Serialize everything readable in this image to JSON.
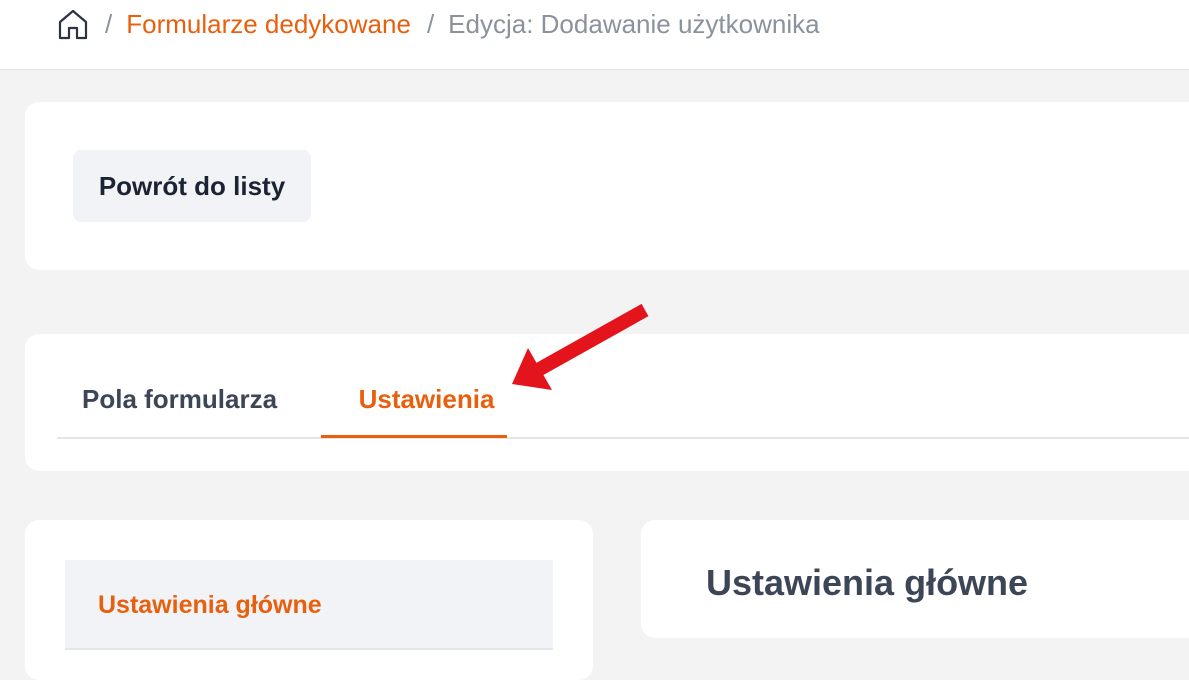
{
  "breadcrumb": {
    "home_icon": "home-icon",
    "separator": "/",
    "link_label": "Formularze dedykowane",
    "current_label": "Edycja: Dodawanie użytkownika"
  },
  "toolbar": {
    "back_label": "Powrót do listy"
  },
  "tabs": [
    {
      "label": "Pola formularza",
      "active": false
    },
    {
      "label": "Ustawienia",
      "active": true
    }
  ],
  "annotation": {
    "icon": "red-arrow-icon",
    "color": "#e3141b",
    "points_to": "Ustawienia"
  },
  "sidebar": {
    "items": [
      {
        "label": "Ustawienia główne",
        "active": true
      }
    ]
  },
  "main": {
    "title": "Ustawienia główne"
  },
  "colors": {
    "accent": "#e8600e",
    "muted_text": "#8a929e",
    "dark_text": "#1c2433",
    "background": "#f3f3f3"
  }
}
